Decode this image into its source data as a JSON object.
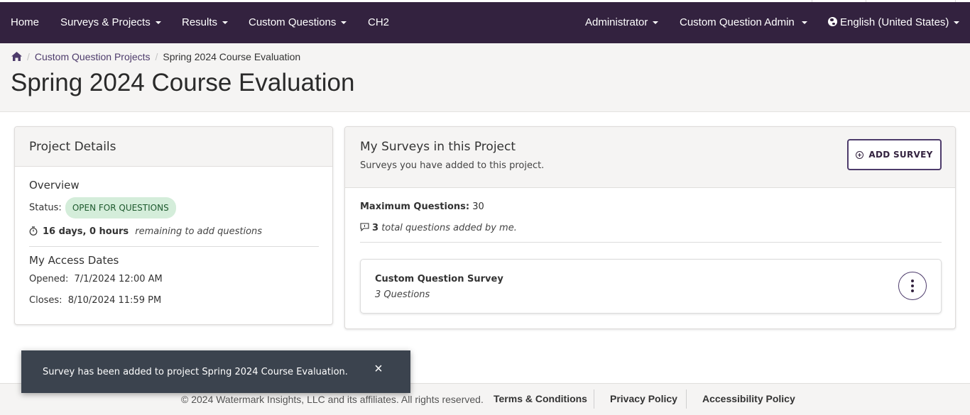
{
  "nav": {
    "home": "Home",
    "surveys_projects": "Surveys & Projects",
    "results": "Results",
    "custom_questions": "Custom Questions",
    "ch2": "CH2",
    "administrator": "Administrator",
    "custom_question_admin": "Custom Question Admin",
    "language": "English (United States)",
    "background_color": "#33223f"
  },
  "breadcrumb": {
    "home_icon": "home-icon",
    "parent": "Custom Question Projects",
    "current": "Spring 2024 Course Evaluation"
  },
  "page_title": "Spring 2024 Course Evaluation",
  "project_details": {
    "title": "Project Details",
    "overview_heading": "Overview",
    "status_label": "Status:",
    "status_value": "OPEN FOR QUESTIONS",
    "timer_icon": "stopwatch-icon",
    "remaining_time": "16 days, 0 hours",
    "remaining_note": "remaining to add questions",
    "access_heading": "My Access Dates",
    "opened_label": "Opened:",
    "opened_value": "7/1/2024 12:00 AM",
    "closes_label": "Closes:",
    "closes_value": "8/10/2024 11:59 PM"
  },
  "my_surveys": {
    "title": "My Surveys in this Project",
    "subtitle": "Surveys you have added to this project.",
    "add_button": "ADD SURVEY",
    "max_questions_label": "Maximum Questions:",
    "max_questions_value": "30",
    "total_count": "3",
    "total_note": "total questions added by me.",
    "surveys": [
      {
        "name": "Custom Question Survey",
        "question_count": "3 Questions"
      }
    ]
  },
  "toast": {
    "message": "Survey has been added to project Spring 2024 Course Evaluation.",
    "close": "×"
  },
  "footer": {
    "copyright": "© 2024 Watermark Insights, LLC and its affiliates. All rights reserved.",
    "terms": "Terms & Conditions",
    "privacy": "Privacy Policy",
    "accessibility": "Accessibility Policy"
  }
}
